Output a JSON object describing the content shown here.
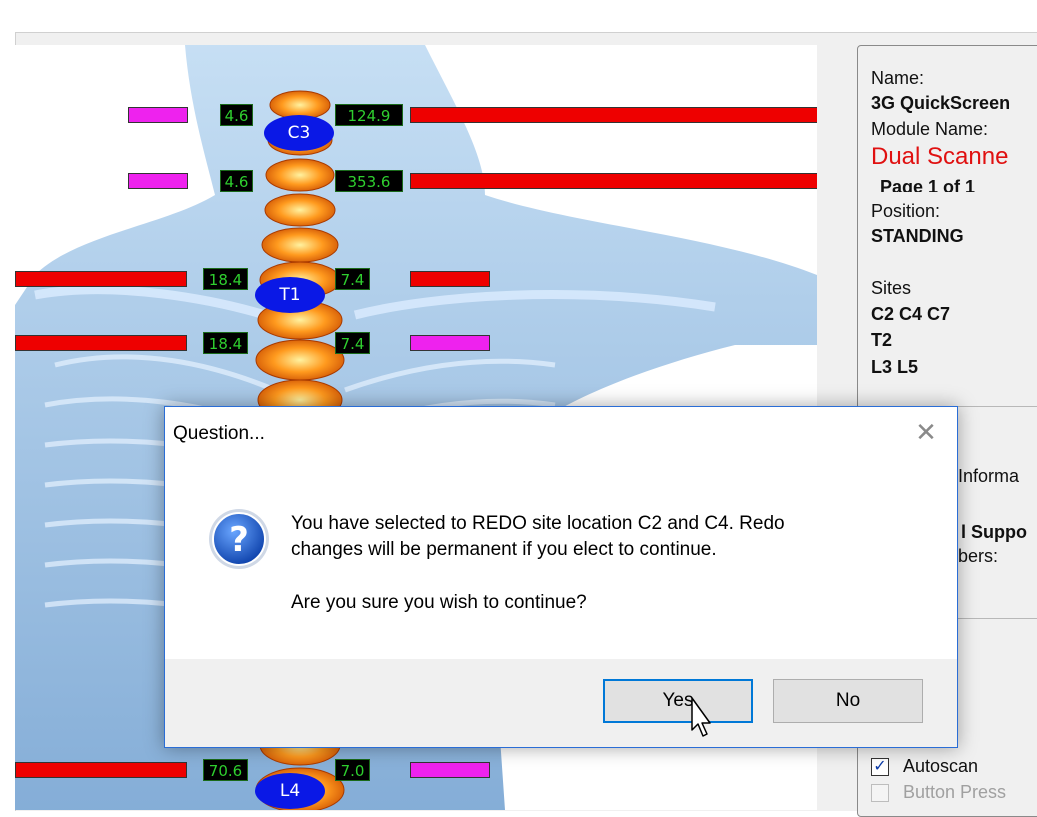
{
  "scan": {
    "vertebra_labels": [
      "C3",
      "T1",
      "L4"
    ],
    "rows": [
      {
        "left_value": "4.6",
        "right_value": "124.9"
      },
      {
        "left_value": "4.6",
        "right_value": "353.6"
      },
      {
        "left_value": "18.4",
        "right_value": "7.4"
      },
      {
        "left_value": "18.4",
        "right_value": "7.4"
      },
      {
        "left_value": "70.6",
        "right_value": "7.0"
      }
    ]
  },
  "info_panel": {
    "name_label": "Name:",
    "name_value": "3G QuickScreen",
    "module_label": "Module Name:",
    "module_value": "Dual Scanne",
    "page": "Page 1 of 1",
    "position_label": "Position:",
    "position_value": "STANDING",
    "sites_label": "Sites",
    "sites_lines": [
      "C2 C4 C7",
      "T2",
      "L3 L5"
    ],
    "partial_info": "Informa",
    "partial_support": "l Suppo",
    "partial_members": "bers:",
    "autoscan_label": "Autoscan",
    "autoscan_checked": true,
    "button_press_label": "Button Press"
  },
  "dialog": {
    "title": "Question...",
    "close_glyph": "✕",
    "message_line1": "You have selected to REDO site location C2 and C4. Redo",
    "message_line2": "changes will be permanent if you elect to continue.",
    "question": "Are you sure you wish to continue?",
    "yes_label": "Yes",
    "no_label": "No"
  },
  "colors": {
    "high_bar": "#ee0000",
    "low_bar": "#ee22ee",
    "value_text": "#2fcf2f",
    "label_fill": "#0a18e6",
    "dialog_border": "#2a6dd6"
  }
}
